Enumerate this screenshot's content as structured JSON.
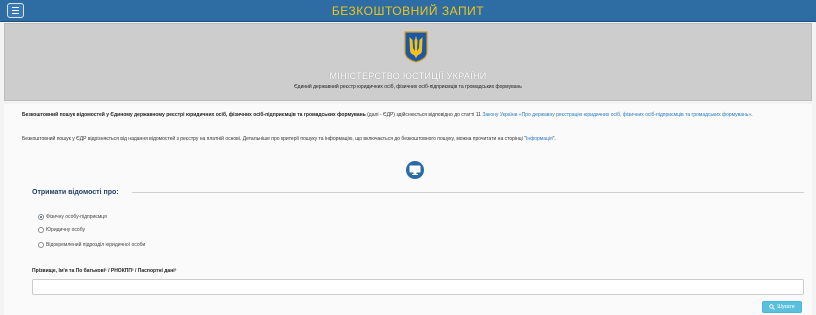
{
  "header": {
    "title": "БЕЗКОШТОВНИЙ ЗАПИТ",
    "menu_icon": "hamburger-menu-icon"
  },
  "hero": {
    "emblem_icon": "ukraine-trident-emblem",
    "ministry": "МІНІСТЕРСТВО ЮСТИЦІЇ УКРАЇНИ",
    "registry": "Єдиний державний реєстр юридичних осіб, фізичних осіб-підприємців та громадських формувань"
  },
  "intro": {
    "bold": "Безкоштовний пошук відомостей у Єдиному державному реєстрі юридичних осіб, фізичних осіб-підприємців та громадських формувань",
    "text": " (далі - ЄДР) здійснюється відповідно до статті 11 ",
    "link": "Закону України «Про державну реєстрацію юридичних осіб, фізичних осіб-підприємців та громадських формувань»",
    "end": "."
  },
  "info": {
    "text": "Безкоштовний пошук у ЄДР відрізняється від надання відомостей з реєстру на платній основі. Детальніше про критерії пошуку та інформацію, що включається до безкоштовного пошуку, можна прочитати на сторінці \"",
    "link": "Інформація",
    "end": "\"."
  },
  "form": {
    "section_title": "Отримати відомості про:",
    "options": [
      {
        "label": "Фізичну особу-підприємця",
        "checked": true
      },
      {
        "label": "Юридичну особу",
        "checked": false
      },
      {
        "label": "Відокремлений підрозділ юридичної особи",
        "checked": false
      }
    ],
    "field_label": "Прізвище, Ім'я та По батькові¹ / РНОКПП² / Паспортні дані³",
    "field_value": "",
    "field_placeholder": "",
    "search_label": "Шукати",
    "search_icon": "search-icon"
  },
  "colors": {
    "header_bg": "#2e6da4",
    "header_title": "#f0c419",
    "hero_bg": "#cdcdcd",
    "link": "#2a7ac0",
    "search_button": "#5bc0de"
  }
}
